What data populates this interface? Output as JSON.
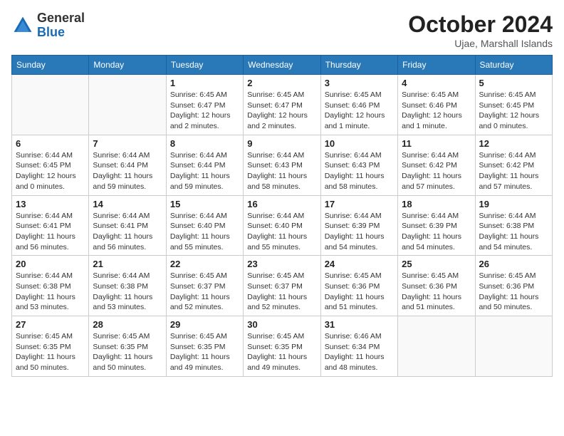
{
  "header": {
    "logo": {
      "text_general": "General",
      "text_blue": "Blue"
    },
    "title": "October 2024",
    "location": "Ujae, Marshall Islands"
  },
  "days_of_week": [
    "Sunday",
    "Monday",
    "Tuesday",
    "Wednesday",
    "Thursday",
    "Friday",
    "Saturday"
  ],
  "weeks": [
    [
      {
        "day": "",
        "info": ""
      },
      {
        "day": "",
        "info": ""
      },
      {
        "day": "1",
        "info": "Sunrise: 6:45 AM\nSunset: 6:47 PM\nDaylight: 12 hours\nand 2 minutes."
      },
      {
        "day": "2",
        "info": "Sunrise: 6:45 AM\nSunset: 6:47 PM\nDaylight: 12 hours\nand 2 minutes."
      },
      {
        "day": "3",
        "info": "Sunrise: 6:45 AM\nSunset: 6:46 PM\nDaylight: 12 hours\nand 1 minute."
      },
      {
        "day": "4",
        "info": "Sunrise: 6:45 AM\nSunset: 6:46 PM\nDaylight: 12 hours\nand 1 minute."
      },
      {
        "day": "5",
        "info": "Sunrise: 6:45 AM\nSunset: 6:45 PM\nDaylight: 12 hours\nand 0 minutes."
      }
    ],
    [
      {
        "day": "6",
        "info": "Sunrise: 6:44 AM\nSunset: 6:45 PM\nDaylight: 12 hours\nand 0 minutes."
      },
      {
        "day": "7",
        "info": "Sunrise: 6:44 AM\nSunset: 6:44 PM\nDaylight: 11 hours\nand 59 minutes."
      },
      {
        "day": "8",
        "info": "Sunrise: 6:44 AM\nSunset: 6:44 PM\nDaylight: 11 hours\nand 59 minutes."
      },
      {
        "day": "9",
        "info": "Sunrise: 6:44 AM\nSunset: 6:43 PM\nDaylight: 11 hours\nand 58 minutes."
      },
      {
        "day": "10",
        "info": "Sunrise: 6:44 AM\nSunset: 6:43 PM\nDaylight: 11 hours\nand 58 minutes."
      },
      {
        "day": "11",
        "info": "Sunrise: 6:44 AM\nSunset: 6:42 PM\nDaylight: 11 hours\nand 57 minutes."
      },
      {
        "day": "12",
        "info": "Sunrise: 6:44 AM\nSunset: 6:42 PM\nDaylight: 11 hours\nand 57 minutes."
      }
    ],
    [
      {
        "day": "13",
        "info": "Sunrise: 6:44 AM\nSunset: 6:41 PM\nDaylight: 11 hours\nand 56 minutes."
      },
      {
        "day": "14",
        "info": "Sunrise: 6:44 AM\nSunset: 6:41 PM\nDaylight: 11 hours\nand 56 minutes."
      },
      {
        "day": "15",
        "info": "Sunrise: 6:44 AM\nSunset: 6:40 PM\nDaylight: 11 hours\nand 55 minutes."
      },
      {
        "day": "16",
        "info": "Sunrise: 6:44 AM\nSunset: 6:40 PM\nDaylight: 11 hours\nand 55 minutes."
      },
      {
        "day": "17",
        "info": "Sunrise: 6:44 AM\nSunset: 6:39 PM\nDaylight: 11 hours\nand 54 minutes."
      },
      {
        "day": "18",
        "info": "Sunrise: 6:44 AM\nSunset: 6:39 PM\nDaylight: 11 hours\nand 54 minutes."
      },
      {
        "day": "19",
        "info": "Sunrise: 6:44 AM\nSunset: 6:38 PM\nDaylight: 11 hours\nand 54 minutes."
      }
    ],
    [
      {
        "day": "20",
        "info": "Sunrise: 6:44 AM\nSunset: 6:38 PM\nDaylight: 11 hours\nand 53 minutes."
      },
      {
        "day": "21",
        "info": "Sunrise: 6:44 AM\nSunset: 6:38 PM\nDaylight: 11 hours\nand 53 minutes."
      },
      {
        "day": "22",
        "info": "Sunrise: 6:45 AM\nSunset: 6:37 PM\nDaylight: 11 hours\nand 52 minutes."
      },
      {
        "day": "23",
        "info": "Sunrise: 6:45 AM\nSunset: 6:37 PM\nDaylight: 11 hours\nand 52 minutes."
      },
      {
        "day": "24",
        "info": "Sunrise: 6:45 AM\nSunset: 6:36 PM\nDaylight: 11 hours\nand 51 minutes."
      },
      {
        "day": "25",
        "info": "Sunrise: 6:45 AM\nSunset: 6:36 PM\nDaylight: 11 hours\nand 51 minutes."
      },
      {
        "day": "26",
        "info": "Sunrise: 6:45 AM\nSunset: 6:36 PM\nDaylight: 11 hours\nand 50 minutes."
      }
    ],
    [
      {
        "day": "27",
        "info": "Sunrise: 6:45 AM\nSunset: 6:35 PM\nDaylight: 11 hours\nand 50 minutes."
      },
      {
        "day": "28",
        "info": "Sunrise: 6:45 AM\nSunset: 6:35 PM\nDaylight: 11 hours\nand 50 minutes."
      },
      {
        "day": "29",
        "info": "Sunrise: 6:45 AM\nSunset: 6:35 PM\nDaylight: 11 hours\nand 49 minutes."
      },
      {
        "day": "30",
        "info": "Sunrise: 6:45 AM\nSunset: 6:35 PM\nDaylight: 11 hours\nand 49 minutes."
      },
      {
        "day": "31",
        "info": "Sunrise: 6:46 AM\nSunset: 6:34 PM\nDaylight: 11 hours\nand 48 minutes."
      },
      {
        "day": "",
        "info": ""
      },
      {
        "day": "",
        "info": ""
      }
    ]
  ]
}
